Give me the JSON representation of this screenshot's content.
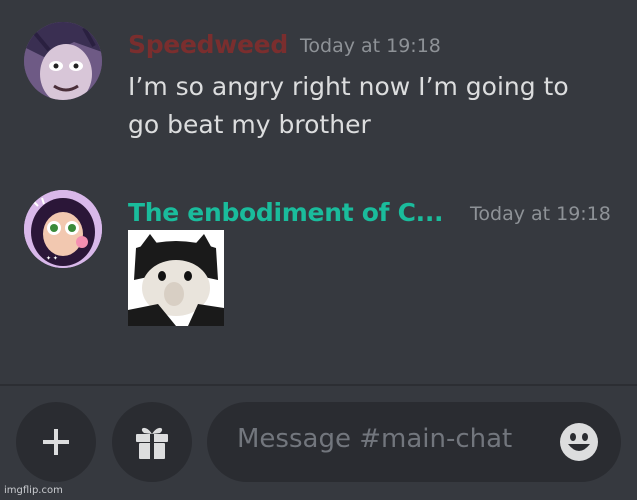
{
  "messages": [
    {
      "username": "Speedweed",
      "username_color": "#7a2e2e",
      "timestamp": "Today at 19:18",
      "lines": [
        "I’m so angry right now I’m going to",
        "go beat my brother"
      ],
      "avatar": "anime-character-avatar"
    },
    {
      "username": "The enbodiment of C...",
      "username_color": "#1abc9c",
      "timestamp": "Today at 19:18",
      "attachment": "cat-image",
      "avatar": "cartoon-girl-avatar"
    }
  ],
  "composer": {
    "placeholder": "Message #main-chat",
    "add_icon": "plus-icon",
    "gift_icon": "gift-icon",
    "emoji_icon": "emoji-smile-icon"
  },
  "watermark": "imgflip.com",
  "colors": {
    "background": "#36393f",
    "input_background": "#2a2c31",
    "timestamp": "#8e9297",
    "text": "#dcddde",
    "placeholder": "#72767d"
  }
}
